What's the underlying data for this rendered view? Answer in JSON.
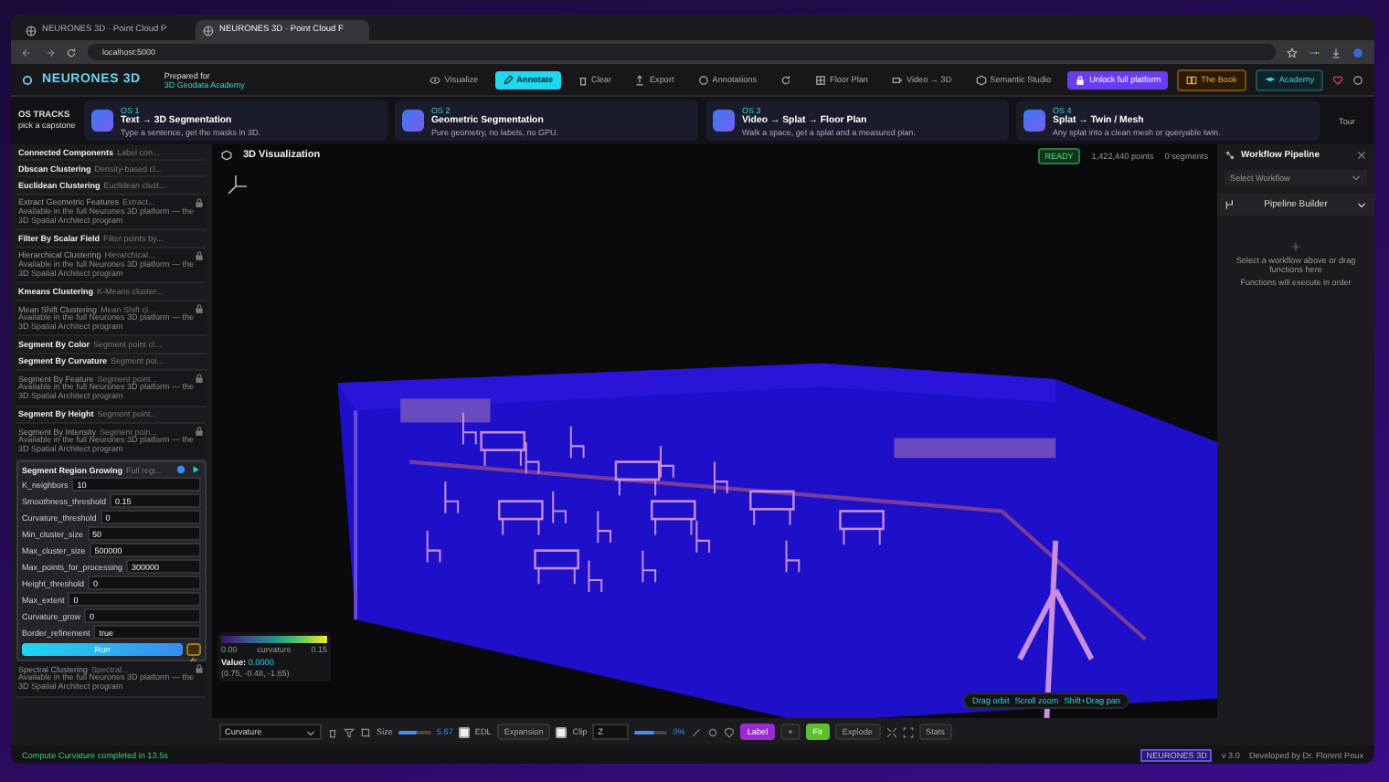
{
  "browser": {
    "tabs": [
      {
        "title": "NEURONES 3D · Point Cloud P",
        "selected": false
      },
      {
        "title": "NEURONES 3D · Point Cloud F",
        "selected": true
      }
    ],
    "url": "localhost:5000"
  },
  "header": {
    "logo": "NEURONES 3D",
    "prepared_label": "Prepared for",
    "prepared_value": "3D Geodata Academy",
    "nav": [
      {
        "label": "Visualize",
        "kind": "plain",
        "selected": false
      },
      {
        "label": "Annotate",
        "kind": "plain",
        "selected": true
      },
      {
        "label": "Clear",
        "kind": "plain",
        "selected": false
      },
      {
        "label": "Export",
        "kind": "plain",
        "selected": false
      },
      {
        "label": "Annotations",
        "kind": "plain",
        "selected": false
      },
      {
        "kind": "icon",
        "selected": false
      },
      {
        "label": "Floor Plan",
        "kind": "plain",
        "selected": false
      },
      {
        "label": "Video → 3D",
        "kind": "plain",
        "selected": false
      },
      {
        "label": "Semantic Studio",
        "kind": "plain",
        "selected": false
      },
      {
        "label": "Unlock full platform",
        "kind": "unlock",
        "selected": false
      },
      {
        "label": "The Book",
        "kind": "book",
        "selected": false
      },
      {
        "label": "Academy",
        "kind": "academy",
        "selected": false
      }
    ]
  },
  "tracks": {
    "title": "OS TRACKS",
    "subtitle": "pick a capstone",
    "tour": "Tour",
    "cards": [
      {
        "code": "OS 1",
        "title": "Text → 3D Segmentation",
        "desc": "Type a sentence, get the masks in 3D."
      },
      {
        "code": "OS 2",
        "title": "Geometric Segmentation",
        "desc": "Pure geometry, no labels, no GPU."
      },
      {
        "code": "OS 3",
        "title": "Video → Splat → Floor Plan",
        "desc": "Walk a space, get a splat and a measured plan."
      },
      {
        "code": "OS 4",
        "title": "Splat → Twin / Mesh",
        "desc": "Any splat into a clean mesh or queryable twin."
      }
    ]
  },
  "functions": [
    {
      "name": "Connected Components",
      "desc": "Label con...",
      "locked": false,
      "expanded": false
    },
    {
      "name": "Dbscan Clustering",
      "desc": "Density-based cl...",
      "locked": false,
      "expanded": false
    },
    {
      "name": "Euclidean Clustering",
      "desc": "Euclidean clust...",
      "locked": false,
      "expanded": false
    },
    {
      "name": "Extract Geometric Features",
      "desc": "Extract...",
      "locked": true,
      "note": "Available in the full Neurones 3D platform — the 3D Spatial Architect program",
      "expanded": false
    },
    {
      "name": "Filter By Scalar Field",
      "desc": "Filter points by...",
      "locked": false,
      "expanded": false
    },
    {
      "name": "Hierarchical Clustering",
      "desc": "Hierarchical...",
      "locked": true,
      "note": "Available in the full Neurones 3D platform — the 3D Spatial Architect program",
      "expanded": false
    },
    {
      "name": "Kmeans Clustering",
      "desc": "K-Means cluster...",
      "locked": false,
      "expanded": false
    },
    {
      "name": "Mean Shift Clustering",
      "desc": "Mean Shift cl...",
      "locked": true,
      "note": "Available in the full Neurones 3D platform — the 3D Spatial Architect program",
      "expanded": false
    },
    {
      "name": "Segment By Color",
      "desc": "Segment point cl...",
      "locked": false,
      "expanded": false
    },
    {
      "name": "Segment By Curvature",
      "desc": "Segment poi...",
      "locked": false,
      "expanded": false
    },
    {
      "name": "Segment By Feature",
      "desc": "Segment point...",
      "locked": true,
      "note": "Available in the full Neurones 3D platform — the 3D Spatial Architect program",
      "expanded": false
    },
    {
      "name": "Segment By Height",
      "desc": "Segment point...",
      "locked": false,
      "expanded": false
    },
    {
      "name": "Segment By Intensity",
      "desc": "Segment poin...",
      "locked": true,
      "note": "Available in the full Neurones 3D platform — the 3D Spatial Architect program",
      "expanded": false
    },
    {
      "name": "Segment Region Growing",
      "desc": "Full regi...",
      "locked": false,
      "expanded": true,
      "run": "Run",
      "params": [
        {
          "name": "K_neighbors",
          "value": "10"
        },
        {
          "name": "Smoothness_threshold",
          "value": "0.15"
        },
        {
          "name": "Curvature_threshold",
          "value": "0"
        },
        {
          "name": "Min_cluster_size",
          "value": "50"
        },
        {
          "name": "Max_cluster_size",
          "value": "500000"
        },
        {
          "name": "Max_points_for_processing",
          "value": "300000"
        },
        {
          "name": "Height_threshold",
          "value": "0"
        },
        {
          "name": "Max_extent",
          "value": "0"
        },
        {
          "name": "Curvature_grow",
          "value": "0"
        },
        {
          "name": "Border_refinement",
          "value": "true"
        }
      ]
    },
    {
      "name": "Spectral Clustering",
      "desc": "Spectral...",
      "locked": true,
      "note": "Available in the full Neurones 3D platform — the 3D Spatial Architect program",
      "expanded": false
    }
  ],
  "status_message": "Compute Curvature completed in 13.5s",
  "viewport": {
    "title": "3D Visualization",
    "badge": "READY",
    "points": "1,422,440 points",
    "segments": "0 segments",
    "legend": {
      "min": "0.00",
      "label": "curvature",
      "max": "0.15",
      "value_label": "Value:",
      "value": "0.0000",
      "coords": "(0.75, -0.48, -1.65)"
    },
    "hints": [
      "Drag orbit",
      "Scroll zoom",
      "Shift+Drag pan"
    ],
    "toolbar": {
      "color_by": "Curvature",
      "size_label": "Size",
      "size": {
        "level": 0.55
      },
      "size_value": "5.67",
      "edl": {
        "label": "EDL",
        "checked": false
      },
      "expansion": "Expansion",
      "clip": {
        "label": "Clip",
        "checked": false
      },
      "axis": "Z",
      "clip_slider": {
        "level": 0.6
      },
      "clip_value": "0%",
      "label_button": "Label",
      "close": "×",
      "fit": "Fit",
      "explode": "Explode",
      "stats": "Stats"
    }
  },
  "pipeline": {
    "title": "Workflow Pipeline",
    "select": "Select Workflow",
    "builder": "Pipeline Builder",
    "empty": "Select a workflow above or drag functions here",
    "empty_sub": "Functions will execute in order"
  },
  "footer": {
    "badge": "NEURONES 3D",
    "version": "v 3.0",
    "credit": "Developed by Dr. Florent Poux"
  }
}
